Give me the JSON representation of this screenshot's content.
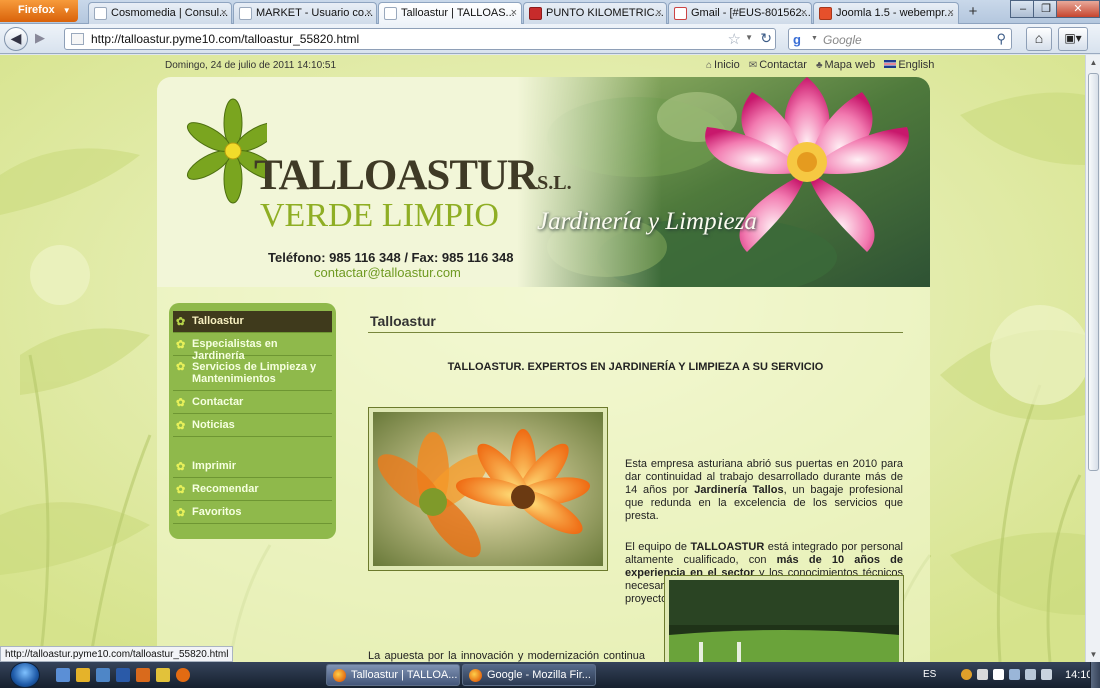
{
  "browser": {
    "menu_label": "Firefox",
    "tabs": [
      {
        "label": "Cosmomedia | Consul...",
        "active": false
      },
      {
        "label": "MARKET - Usuario co...",
        "active": false
      },
      {
        "label": "Talloastur | TALLOAS...",
        "active": true
      },
      {
        "label": "PUNTO KILOMETRIC...",
        "active": false
      },
      {
        "label": "Gmail - [#EUS-801562...",
        "active": false
      },
      {
        "label": "Joomla 1.5 - webempr...",
        "active": false
      }
    ],
    "url": "http://talloastur.pyme10.com/talloastur_55820.html",
    "search_placeholder": "Google",
    "status_url": "http://talloastur.pyme10.com/talloastur_55820.html"
  },
  "page": {
    "date_line": "Domingo, 24 de julio de 2011 14:10:51",
    "top_links": [
      "Inicio",
      "Contactar",
      "Mapa web",
      "English"
    ],
    "logo_main": "TALLOASTUR",
    "logo_suffix": "S.L.",
    "logo_sub": "VERDE LIMPIO",
    "tagline": "Jardinería y Limpieza",
    "phone": "Teléfono: 985 116 348 / Fax: 985 116 348",
    "email": "contactar@talloastur.com",
    "menu": [
      {
        "label": "Talloastur",
        "active": true
      },
      {
        "label": "Especialistas en Jardinería",
        "active": false
      },
      {
        "label": "Servicios de Limpieza y Mantenimientos",
        "active": false
      },
      {
        "label": "Contactar",
        "active": false
      },
      {
        "label": "Noticias",
        "active": false
      },
      {
        "label": "Imprimir",
        "active": false
      },
      {
        "label": "Recomendar",
        "active": false
      },
      {
        "label": "Favoritos",
        "active": false
      }
    ],
    "title": "Talloastur",
    "headline": "TALLOASTUR. EXPERTOS EN JARDINERÍA Y LIMPIEZA A SU SERVICIO",
    "para1": {
      "a": "Esta empresa asturiana abrió sus puertas en 2010 para dar continuidad al trabajo desarrollado durante más de 14 años por ",
      "b": "Jardinería Tallos",
      "c": ", un bagaje profesional que redunda en la excelencia de los servicios que presta."
    },
    "para2": {
      "a": "El equipo de ",
      "b": "TALLOASTUR",
      "c": " está integrado por personal altamente cualificado, con ",
      "d": "más de 10 años de experiencia en el sector",
      "e": " y los conocimientos técnicos necesarios para garantizar la calidad total en cada proyecto."
    },
    "para3": "La apuesta por la innovación y modernización continua de maquinaria, una de nuestras señas de identidad, nos permite ser más respetuosos con el medio ambiente e incrementar nuestra eficiencia."
  },
  "taskbar": {
    "tasks": [
      {
        "label": "Talloastur | TALLOA...",
        "active": true
      },
      {
        "label": "Google - Mozilla Fir...",
        "active": false
      }
    ],
    "lang": "ES",
    "clock": "14:10"
  },
  "colors": {
    "menu_bg": "#8fb94b",
    "menu_active": "#3f3a1c",
    "accent_green": "#8fae24",
    "page_bg": "#e6efb4"
  },
  "icons": [
    "firefox-menu-icon",
    "back-arrow-icon",
    "forward-arrow-icon",
    "bookmark-star-icon",
    "reload-icon",
    "google-icon",
    "search-icon",
    "home-icon",
    "home-link-icon",
    "mail-icon",
    "sitemap-icon",
    "uk-flag-icon",
    "flower-bullet-icon",
    "windows-start-icon"
  ]
}
